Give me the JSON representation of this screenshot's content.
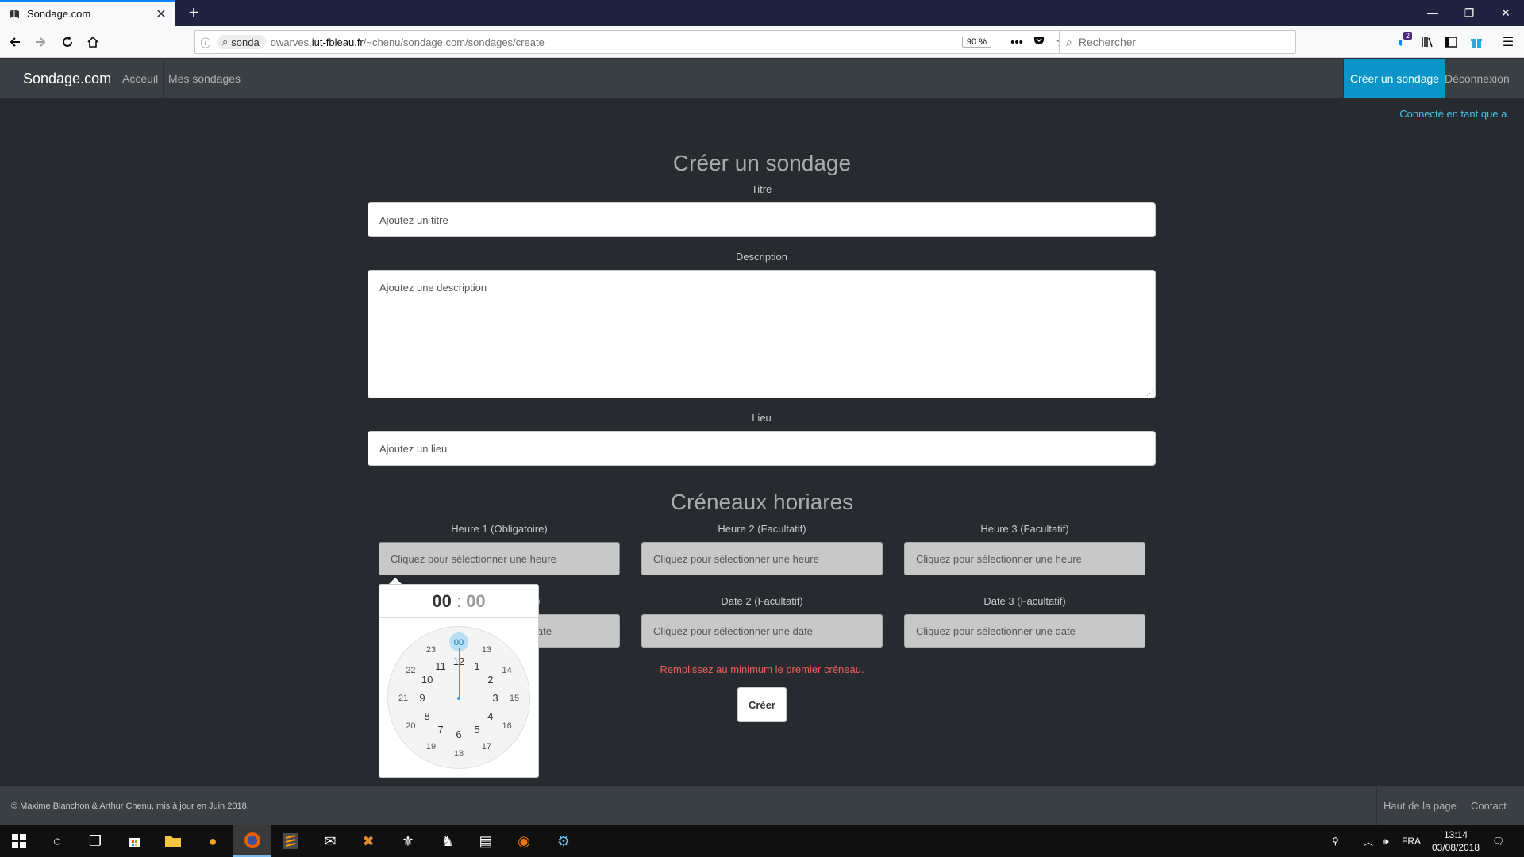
{
  "browser": {
    "tab_title": "Sondage.com",
    "url_chip": "sonda",
    "url_prefix": "dwarves.",
    "url_domain": "iut-fbleau.fr",
    "url_path": "/~chenu/sondage.com/sondages/create",
    "zoom": "90 %",
    "search_placeholder": "Rechercher",
    "notif_count": "2"
  },
  "site": {
    "brand": "Sondage.com",
    "nav": [
      "Acceuil",
      "Mes sondages"
    ],
    "create_link": "Créer un sondage",
    "logout_link": "Déconnexion",
    "connected_text": "Connecté en tant que a."
  },
  "form": {
    "heading": "Créer un sondage",
    "title_label": "Titre",
    "title_placeholder": "Ajoutez un titre",
    "description_label": "Description",
    "description_placeholder": "Ajoutez une description",
    "place_label": "Lieu",
    "place_placeholder": "Ajoutez un lieu",
    "slots_heading": "Créneaux horiares",
    "hour_labels": [
      "Heure 1 (Obligatoire)",
      "Heure 2 (Facultatif)",
      "Heure 3 (Facultatif)"
    ],
    "hour_placeholder": "Cliquez pour sélectionner une heure",
    "date_labels": [
      "Date 1 (Obligatoire)",
      "Date 2 (Facultatif)",
      "Date 3 (Facultatif)"
    ],
    "date_label_1_visible": "e)",
    "date_1_visible": "ate",
    "date_placeholder": "Cliquez pour sélectionner une date",
    "error": "Remplissez au minimum le premier créneau.",
    "submit": "Créer"
  },
  "clock": {
    "hours": "00",
    "separator": ":",
    "minutes": "00",
    "inner": [
      "12",
      "1",
      "2",
      "3",
      "4",
      "5",
      "6",
      "7",
      "8",
      "9",
      "10",
      "11"
    ],
    "outer": [
      "00",
      "13",
      "14",
      "15",
      "16",
      "17",
      "18",
      "19",
      "20",
      "21",
      "22",
      "23"
    ],
    "selected": "00"
  },
  "footer": {
    "copyright": "© Maxime Blanchon & Arthur Chenu, mis à jour en Juin 2018.",
    "top_link": "Haut de la page",
    "contact_link": "Contact"
  },
  "taskbar": {
    "lang": "FRA",
    "time": "13:14",
    "date": "03/08/2018"
  },
  "icons": {
    "back": "arrow-left-icon",
    "forward": "arrow-right-icon",
    "reload": "reload-icon",
    "home": "home-icon",
    "search": "search-icon",
    "menu": "hamburger-icon"
  }
}
